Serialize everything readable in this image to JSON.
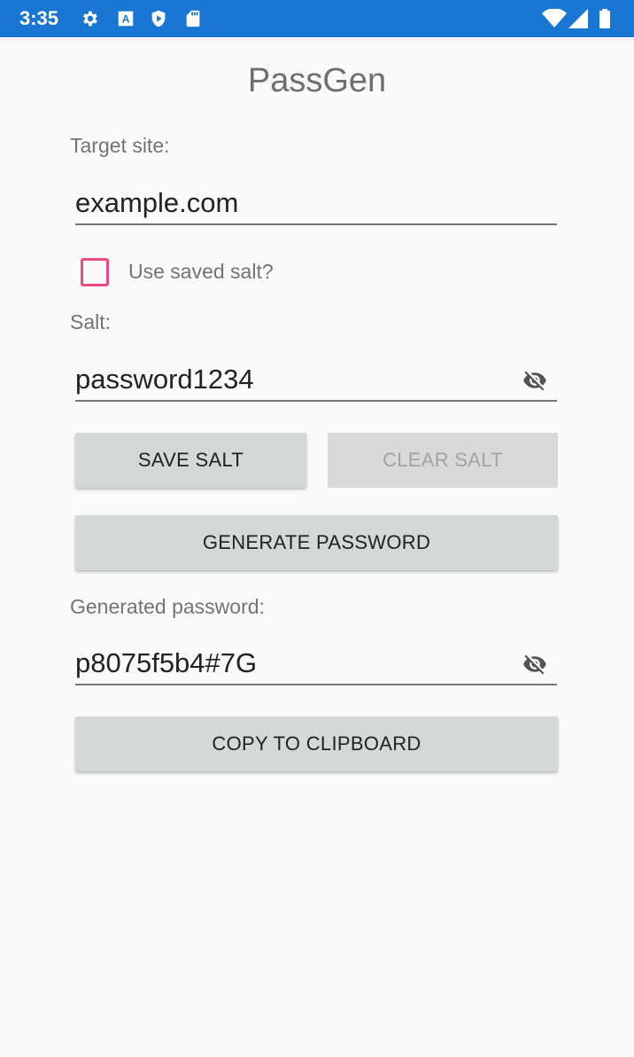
{
  "status_bar": {
    "time": "3:35",
    "left_icons": [
      "gear-icon",
      "a-icon",
      "shield-icon",
      "sd-card-icon"
    ],
    "right_icons": [
      "wifi-icon",
      "signal-icon",
      "battery-icon"
    ],
    "color": "#1976d2"
  },
  "app": {
    "title": "PassGen"
  },
  "target_site": {
    "label": "Target site:",
    "value": "example.com"
  },
  "saved_salt_checkbox": {
    "label": "Use saved salt?",
    "checked": false,
    "color": "#e91e63"
  },
  "salt": {
    "label": "Salt:",
    "value": "password1234",
    "visibility_icon": "eye-off-icon"
  },
  "buttons": {
    "save_salt": "SAVE SALT",
    "clear_salt": "CLEAR SALT",
    "generate": "GENERATE PASSWORD",
    "copy": "COPY TO CLIPBOARD"
  },
  "generated": {
    "label": "Generated password:",
    "value": "p8075f5b4#7G",
    "visibility_icon": "eye-off-icon"
  }
}
